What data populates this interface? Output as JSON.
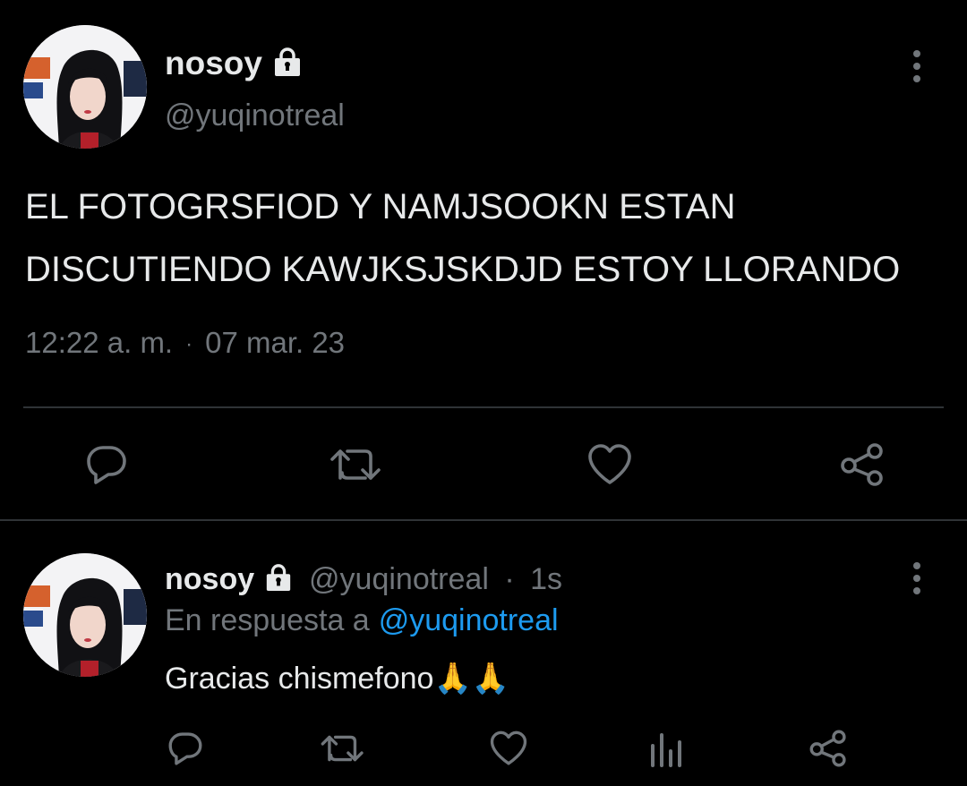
{
  "main_tweet": {
    "display_name": "nosoy",
    "handle": "@yuqinotreal",
    "text_line1": "EL FOTOGRSFIOD Y NAMJSOOKN ESTAN",
    "text_line2": "DISCUTIENDO KAWJKSJSKDJD ESTOY LLORANDO",
    "time": "12:22 a. m.",
    "separator": "·",
    "date": "07 mar. 23",
    "actions": [
      "reply-icon",
      "retweet-icon",
      "like-icon",
      "share-icon"
    ]
  },
  "reply_tweet": {
    "display_name": "nosoy",
    "handle": "@yuqinotreal",
    "separator": "·",
    "age": "1s",
    "reply_prefix": "En respuesta a",
    "reply_mention": "@yuqinotreal",
    "text": "Gracias chismefono",
    "emoji": "🙏🙏",
    "actions": [
      "reply-icon",
      "retweet-icon",
      "like-icon",
      "analytics-icon",
      "share-icon"
    ]
  },
  "colors": {
    "background": "#000000",
    "text_primary": "#e7e9ea",
    "text_secondary": "#71767b",
    "accent_link": "#1d9bf0",
    "divider": "#2f3336"
  }
}
